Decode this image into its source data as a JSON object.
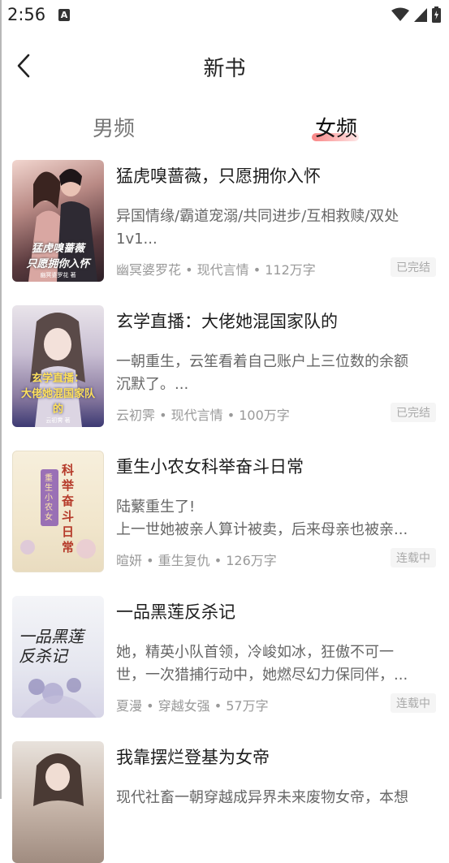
{
  "status_bar": {
    "time": "2:56"
  },
  "header": {
    "title": "新书"
  },
  "tabs": [
    {
      "label": "男频",
      "active": false
    },
    {
      "label": "女频",
      "active": true
    }
  ],
  "books": [
    {
      "title": "猛虎嗅蔷薇，只愿拥你入怀",
      "desc": "异国情缘/霸道宠溺/共同进步/互相救赎/双处\n1v1...",
      "meta": "幽冥婆罗花 • 现代言情 • 112万字",
      "status": "已完结",
      "cover_title": "猛虎嗅蔷薇\n只愿拥你入怀",
      "cover_author": "幽冥婆罗花 著"
    },
    {
      "title": "玄学直播：大佬她混国家队的",
      "desc": "一朝重生，云笙看着自己账户上三位数的余额\n沉默了。...",
      "meta": "云初霁 • 现代言情 • 100万字",
      "status": "已完结",
      "cover_title": "玄学直播：\n大佬她混国家队的",
      "cover_author": "云初霁 著"
    },
    {
      "title": "重生小农女科举奋斗日常",
      "desc": "陆蘩重生了!\n上一世她被亲人算计被卖，后来母亲也被亲...",
      "meta": "暄妍 • 重生复仇 • 126万字",
      "status": "连载中",
      "cover_title": "科举奋斗日常",
      "cover_author": "重生小农女"
    },
    {
      "title": "一品黑莲反杀记",
      "desc": "她，精英小队首领，冷峻如冰，狂傲不可一\n世，一次猎捕行动中，她燃尽幻力保同伴，...",
      "meta": "夏漫 • 穿越女强 • 57万字",
      "status": "连载中",
      "cover_title": "一品黑莲\n反杀记",
      "cover_author": ""
    },
    {
      "title": "我靠摆烂登基为女帝",
      "desc": "现代社畜一朝穿越成异界未来废物女帝，本想",
      "meta": "",
      "status": "",
      "cover_title": "",
      "cover_author": ""
    }
  ],
  "colors": {
    "accent": "#f97878",
    "text": "#222222",
    "muted": "#999999"
  }
}
